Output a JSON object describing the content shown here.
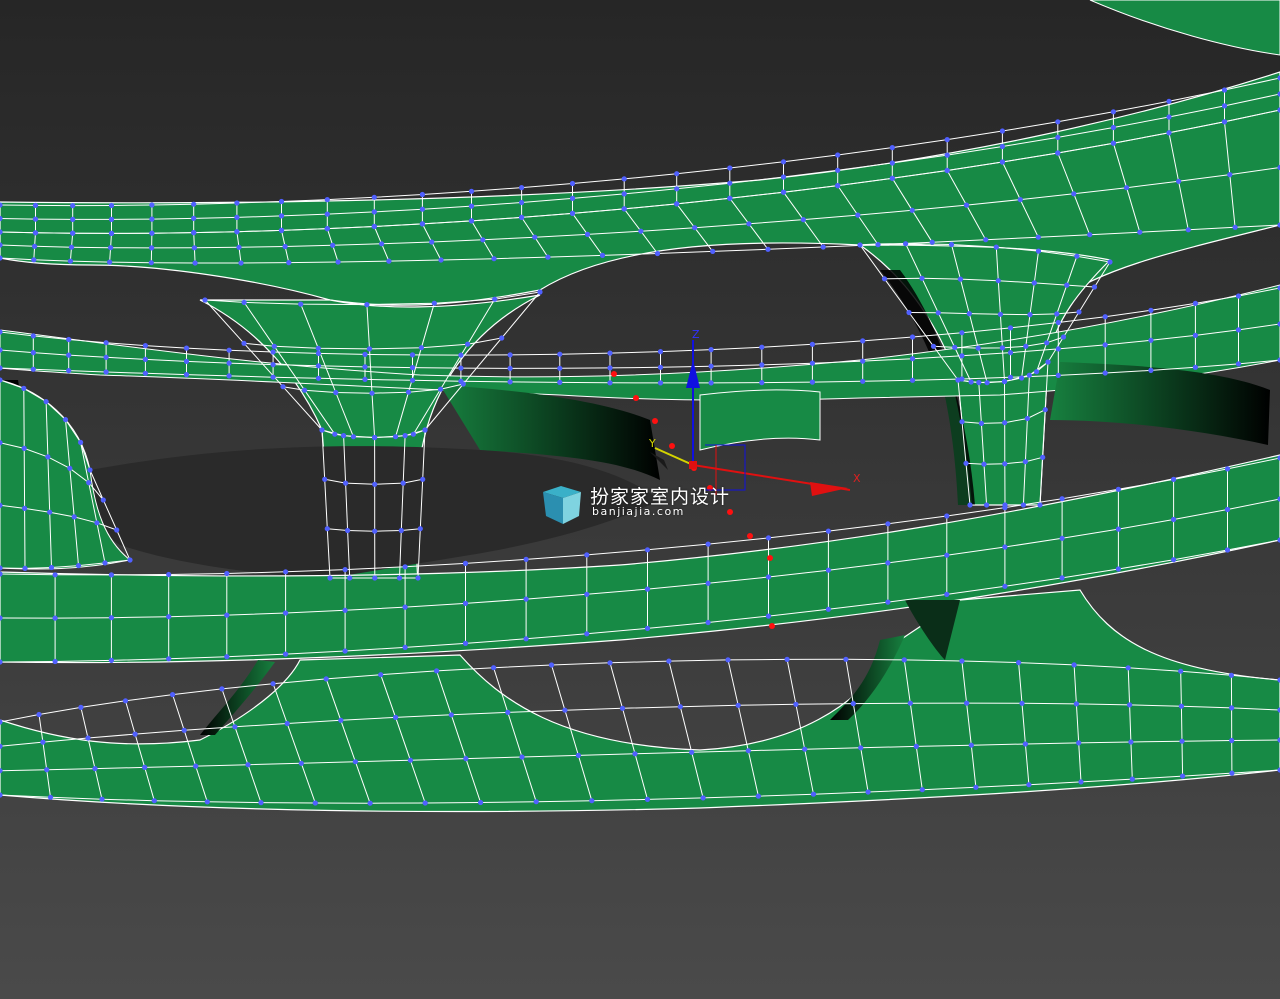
{
  "viewport": {
    "background_top": "#262626",
    "background_bottom": "#4a4a4a"
  },
  "mesh": {
    "face_color": "#178a45",
    "face_dark": "#0a2e18",
    "wire_color": "#ffffff",
    "vertex_color": "#5060ff"
  },
  "gizmo": {
    "x_label": "X",
    "y_label": "Y",
    "z_label": "Z",
    "x_color": "#e01010",
    "y_color": "#d4d400",
    "z_color": "#1010e0",
    "selection_color": "#ff1010"
  },
  "watermark": {
    "icon": "cube-logo-icon",
    "title": "扮家家室内设计",
    "url": "banjiajia.com"
  }
}
